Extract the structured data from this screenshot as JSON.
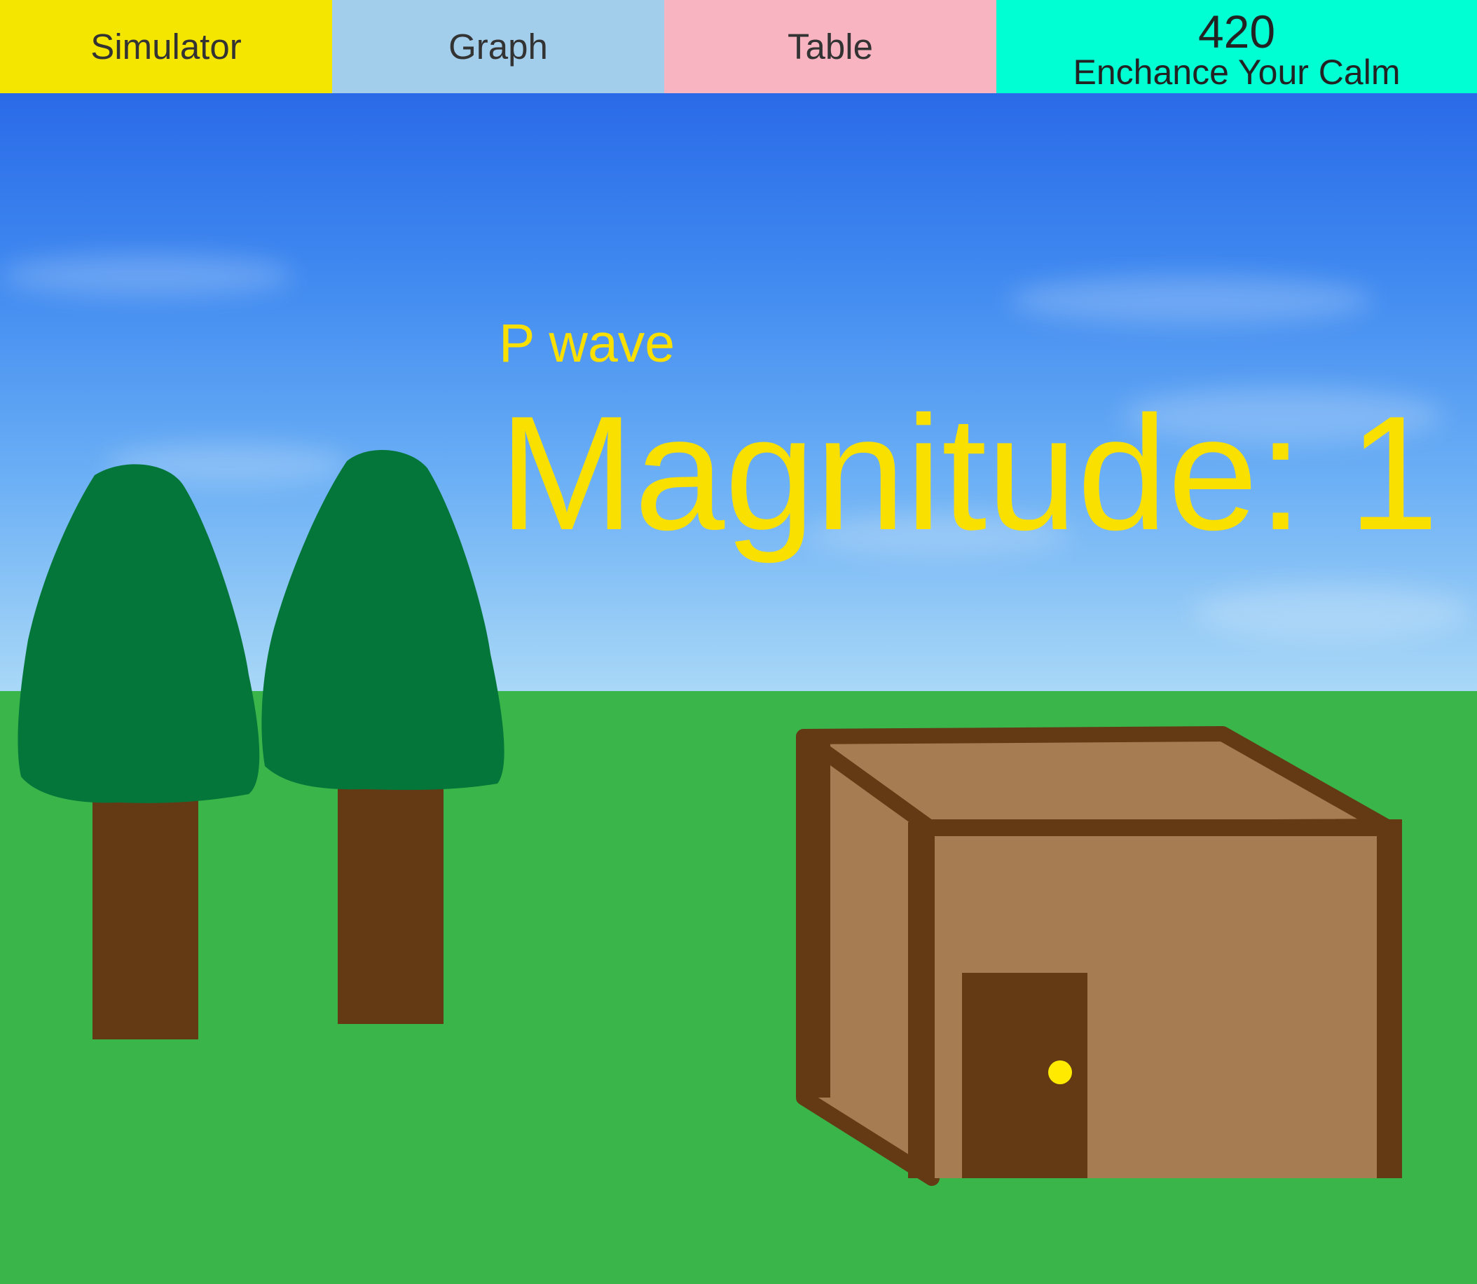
{
  "tabs": {
    "simulator": "Simulator",
    "graph": "Graph",
    "table": "Table",
    "calm_count": "420",
    "calm_label": "Enchance Your Calm"
  },
  "scene": {
    "wave_type": "P wave",
    "magnitude_text": "Magnitude: 1"
  },
  "colors": {
    "sky_top": "#2a6ae8",
    "sky_bottom": "#a9d8f7",
    "grass": "#3ab54a",
    "tree_foliage": "#05763a",
    "trunk": "#633a14",
    "house_wall": "#a67c52",
    "house_trim": "#633a14",
    "door_knob": "#ffea00",
    "label_yellow": "#fae000"
  }
}
